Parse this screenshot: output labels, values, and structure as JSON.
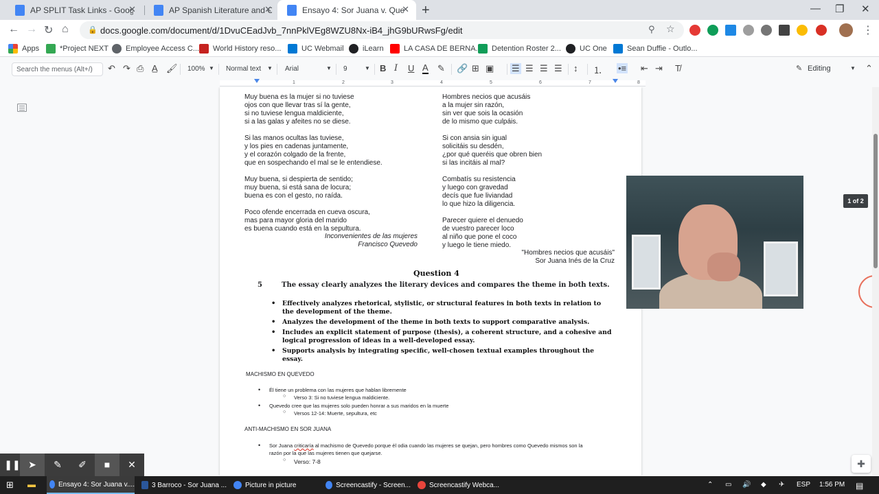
{
  "browser": {
    "tabs": [
      {
        "title": "AP SPLIT Task Links - Google Doc",
        "color": "#4285f4"
      },
      {
        "title": "AP Spanish Literature and Cultur",
        "color": "#4285f4"
      },
      {
        "title": "Ensayo 4: Sor Juana v. Quevedo",
        "color": "#4285f4",
        "active": true
      }
    ],
    "url": "docs.google.com/document/d/1DvuCEadJvb_7nnPklVEg8WZU8Nx-iB4_jhG9bURwsFg/edit",
    "bookmarks": [
      {
        "label": "Apps",
        "color": "#ea4335"
      },
      {
        "label": "*Project NEXT",
        "color": "#34a853"
      },
      {
        "label": "Employee Access C...",
        "color": "#5f6368"
      },
      {
        "label": "World History reso...",
        "color": "#c5221f"
      },
      {
        "label": "UC Webmail",
        "color": "#0078d4"
      },
      {
        "label": "iLearn",
        "color": "#202124"
      },
      {
        "label": "LA CASA DE BERNA...",
        "color": "#ff0000"
      },
      {
        "label": "Detention Roster 2...",
        "color": "#0f9d58"
      },
      {
        "label": "UC One",
        "color": "#202124"
      },
      {
        "label": "Sean Duffie - Outlo...",
        "color": "#0078d4"
      }
    ]
  },
  "docs_toolbar": {
    "menu_search_placeholder": "Search the menus (Alt+/)",
    "zoom": "100%",
    "style": "Normal text",
    "font": "Arial",
    "font_size": "9",
    "mode": "Editing"
  },
  "ruler": {
    "marks": [
      "1",
      "2",
      "3",
      "4",
      "5",
      "6",
      "7",
      "8"
    ]
  },
  "document": {
    "quevedo_poem": [
      "Muy buena es la mujer si no tuviese",
      "ojos con que llevar tras sí la gente,",
      "si no tuviese lengua maldiciente,",
      "si a las galas y afeites no se diese.",
      "",
      "Si las manos ocultas las tuviese,",
      "y los pies en cadenas juntamente,",
      "y el corazón colgado de la frente,",
      "que en sospechando el mal se le entendiese.",
      "",
      "Muy buena, si despierta de sentido;",
      "muy buena, si está sana de locura;",
      "buena es con el gesto, no raída.",
      "",
      "Poco ofende encerrada en cueva oscura,",
      "mas para mayor gloria del marido",
      "es buena cuando está en la sepultura."
    ],
    "quevedo_title": "Inconvenientes de las mujeres",
    "quevedo_author": "Francisco Quevedo",
    "sorjuana_poem": [
      "Hombres necios que acusáis",
      "a la mujer sin razón,",
      "sin ver que sois la ocasión",
      "de lo mismo que culpáis.",
      "",
      "Si con ansia sin igual",
      "solicitáis su desdén,",
      "¿por qué queréis que obren bien",
      "si las incitáis al mal?",
      "",
      "Combatís su resistencia",
      "y luego con gravedad",
      "decís que fue liviandad",
      "lo que hizo la diligencia.",
      "",
      "Parecer quiere el denuedo",
      "de vuestro parecer loco",
      "al niño que pone el coco",
      "y luego le tiene miedo."
    ],
    "sorjuana_title": "\"Hombres necios que acusáis\"",
    "sorjuana_author": "Sor Juana Inés de la Cruz",
    "question_title": "Question 4",
    "score": "5",
    "score_heading": "The essay clearly analyzes the literary devices and compares the theme in both texts.",
    "rubric": [
      "Effectively analyzes rhetorical, stylistic, or structural features in both texts in relation to the development of the theme.",
      "Analyzes the development of the theme in both texts to support comparative analysis.",
      "Includes an explicit statement of purpose (thesis), a coherent structure, and a cohesive and logical progression of ideas in a well-developed essay.",
      "Supports analysis by integrating specific, well-chosen textual examples throughout the essay."
    ],
    "section1_title": "MACHISMO EN QUEVEDO",
    "section1_b1": "Él tiene un problema con las mujeres que hablan libremente",
    "section1_b1_sub": "Verso 3: Si no tuviese lengua maldiciente.",
    "section1_b2": "Quevedo cree que las mujeres solo pueden honrar a sus maridos en la muerte",
    "section1_b2_sub": "Versos 12-14: Muerte, sepultura, etc",
    "section2_title": "ANTI-MACHISMO EN SOR JUANA",
    "section2_b1_pre": "Sor Juana ",
    "section2_b1_spell": "criticaría",
    "section2_b1_post": " al machismo de Quevedo porque él odia cuando las mujeres se quejan, pero hombres como Quevedo mismos son la",
    "section2_b1_line2": "razón por la que las mujeres tienen que quejarse.",
    "section2_b1_sub": "Verso: 7-8"
  },
  "page_indicator": "1 of 2",
  "taskbar": {
    "items": [
      {
        "label": "Ensayo 4: Sor Juana v....",
        "color": "#4285f4",
        "active": true
      },
      {
        "label": "3 Barroco - Sor Juana ...",
        "color": "#2b579a"
      },
      {
        "label": "Picture in picture",
        "color": "#4285f4"
      },
      {
        "label": "Screencastify - Screen...",
        "color": "#4285f4"
      },
      {
        "label": "Screencastify Webca...",
        "color": "#e8453c"
      }
    ],
    "language": "ESP",
    "time": "1:56 PM"
  }
}
